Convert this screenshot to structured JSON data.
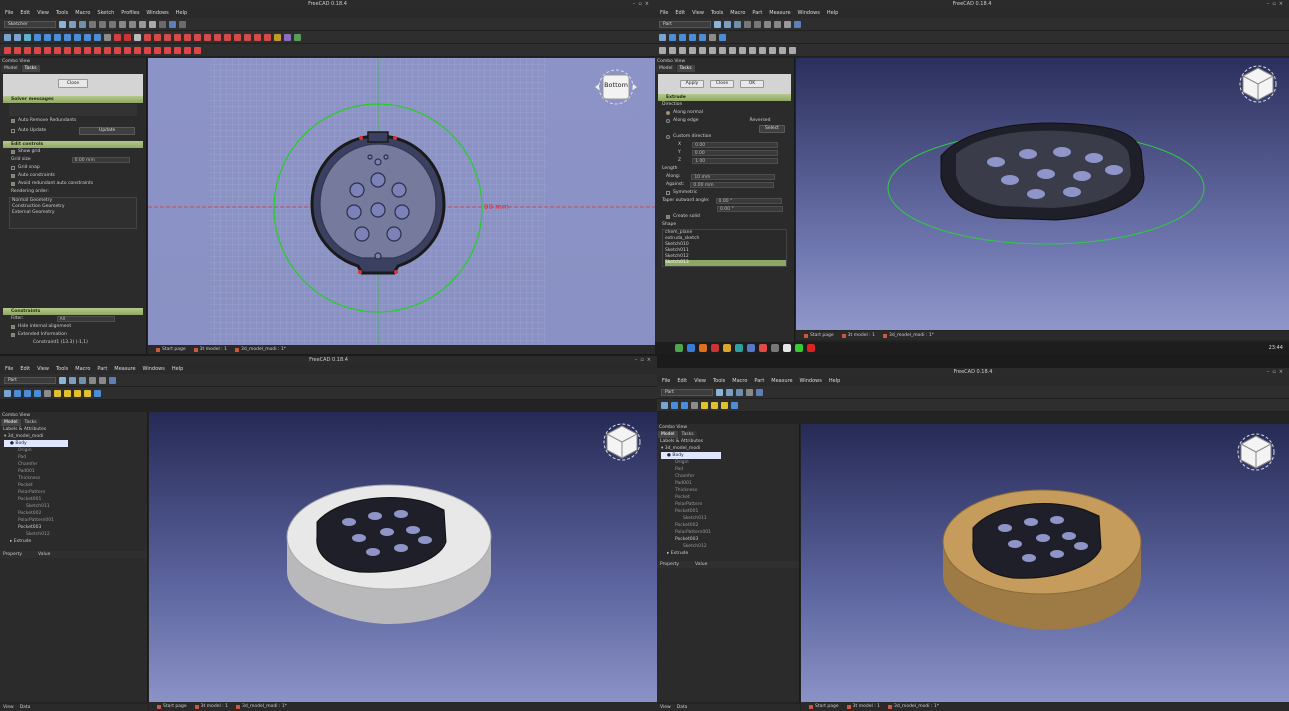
{
  "windows": {
    "tl": {
      "title": "FreeCAD 0.18.4",
      "menus": [
        "File",
        "Edit",
        "View",
        "Tools",
        "Macro",
        "Sketch",
        "Profiles",
        "Windows",
        "Help"
      ],
      "workbench": "Sketcher",
      "combo_title": "Combo View",
      "tabs": [
        "Model",
        "Tasks"
      ],
      "close_label": "Close",
      "solver_title": "Solver messages",
      "auto_remove": "Auto Remove Redundants",
      "auto_update": "Auto Update",
      "update_btn": "Update",
      "edit_title": "Edit controls",
      "show_grid": "Show grid",
      "grid_size_label": "Grid size",
      "grid_size_value": "0.00 mm",
      "grid_snap": "Grid snap",
      "auto_constraints": "Auto constraints",
      "avoid_redundant": "Avoid redundant auto constraints",
      "render_order": "Rendering order:",
      "render_items": [
        "Normal Geometry",
        "Construction Geometry",
        "External Geometry"
      ],
      "constraints_title": "Constraints",
      "filter_label": "Filter:",
      "filter_value": "All",
      "hide_internal": "Hide internal alignment",
      "extended_info": "Extended Information",
      "constraint_item": "Constraint1 (13.3) (-1,1)",
      "dimension_label": "90 mm",
      "nav_face": "Bottom",
      "bottom_tabs": [
        "Start page",
        "3t model : 1",
        "3d_model_modi : 1*"
      ]
    },
    "tr": {
      "workbench": "Part",
      "menus": [
        "File",
        "Edit",
        "View",
        "Tools",
        "Macro",
        "Part",
        "Measure",
        "Windows",
        "Help"
      ],
      "combo_title": "Combo View",
      "tabs": [
        "Model",
        "Tasks"
      ],
      "buttons": [
        "Apply",
        "Close",
        "OK"
      ],
      "extrude_title": "Extrude",
      "direction_label": "Direction",
      "along_normal": "Along normal",
      "along_edge": "Along edge",
      "reversed": "Reversed",
      "select": "Select",
      "custom_direction": "Custom direction",
      "axes": [
        "X",
        "Y",
        "Z"
      ],
      "axis_values": [
        "0.00",
        "0.00",
        "1.00"
      ],
      "length_label": "Length",
      "along_label": "Along:",
      "along_value": "10 mm",
      "against_label": "Against:",
      "against_value": "0.00 mm",
      "symmetric": "Symmetric",
      "taper_label": "Taper outward angle:",
      "taper_value": "0.00 °",
      "taper_value2": "0.00 °",
      "create_solid": "Create solid",
      "shape_label": "Shape",
      "shapes": [
        "chem_plane",
        "extruda_sketch",
        "Sketch010",
        "Sketch011",
        "Sketch012",
        "Sketch013"
      ],
      "bottom_tabs": [
        "Start page",
        "3t model : 1",
        "3d_model_modi : 1*"
      ],
      "clock": "23:44"
    },
    "bl": {
      "title": "FreeCAD 0.18.4",
      "menus": [
        "File",
        "Edit",
        "View",
        "Tools",
        "Macro",
        "Part",
        "Measure",
        "Windows",
        "Help"
      ],
      "workbench": "Part",
      "combo_title": "Combo View",
      "tabs": [
        "Model",
        "Tasks"
      ],
      "labels_title": "Labels & Attributes",
      "tree": [
        "3d_model_modi",
        "Body",
        "Origin",
        "Pad",
        "Chamfer",
        "Pad001",
        "Thickness",
        "Pocket",
        "PolarPattern",
        "Pocket001",
        "Sketch011",
        "Pocket002",
        "PolarPattern001",
        "Pocket003",
        "Sketch012",
        "Extrude"
      ],
      "prop_headers": [
        "Property",
        "Value"
      ],
      "bottom_views": [
        "View",
        "Data"
      ],
      "bottom_tabs": [
        "Start page",
        "3t model : 1",
        "3d_model_modi : 1*"
      ]
    },
    "br": {
      "title": "FreeCAD 0.18.4",
      "menus": [
        "File",
        "Edit",
        "View",
        "Tools",
        "Macro",
        "Part",
        "Measure",
        "Windows",
        "Help"
      ],
      "workbench": "Part",
      "combo_title": "Combo View",
      "tabs": [
        "Model",
        "Tasks"
      ],
      "labels_title": "Labels & Attributes",
      "tree": [
        "3d_model_modi",
        "Body",
        "Origin",
        "Pad",
        "Chamfer",
        "Pad001",
        "Thickness",
        "Pocket",
        "PolarPattern",
        "Pocket001",
        "Sketch011",
        "Pocket002",
        "PolarPattern001",
        "Pocket003",
        "Sketch012",
        "Extrude"
      ],
      "prop_headers": [
        "Property",
        "Value"
      ],
      "bottom_views": [
        "View",
        "Data"
      ],
      "bottom_tabs": [
        "Start page",
        "3t model : 1",
        "3d_model_modi : 1*"
      ]
    }
  },
  "colors": {
    "section_green": "#a6bd78",
    "viewport_top": "#2a2e58",
    "viewport_bottom": "#8f97c9",
    "sketch_bg": "#7f86b8",
    "wood": "#c59c5c"
  }
}
